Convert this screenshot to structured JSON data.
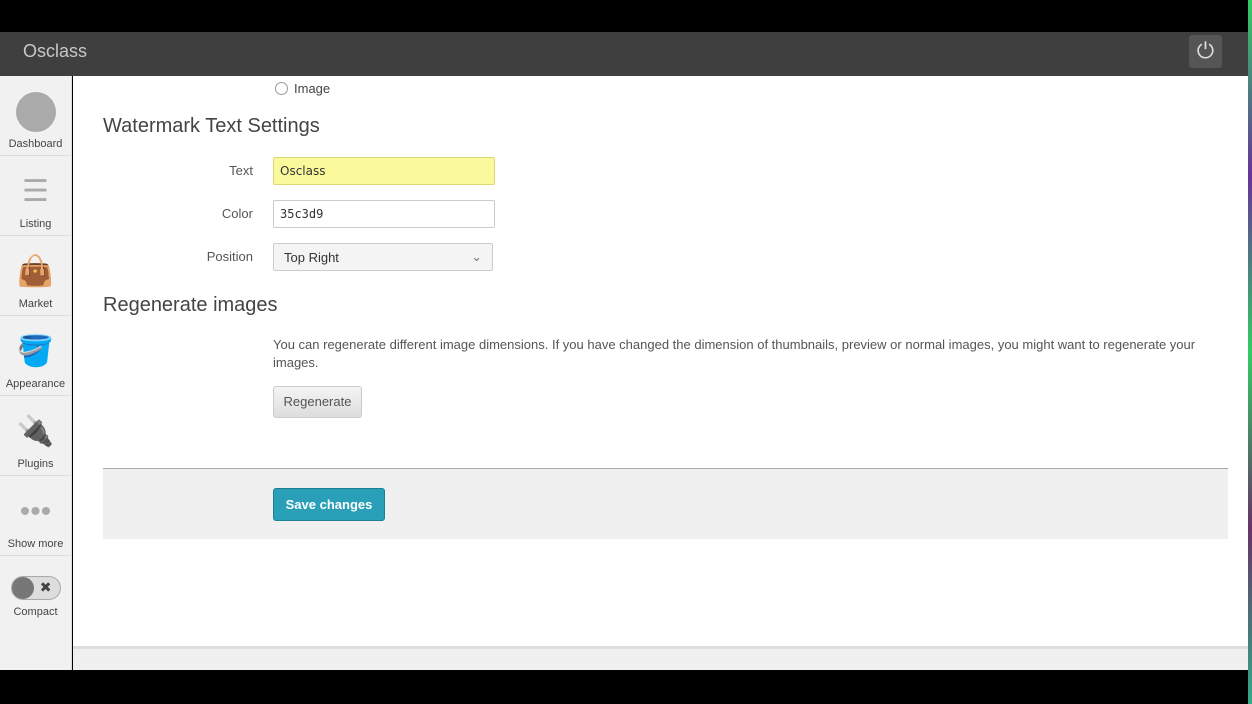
{
  "header": {
    "brand": "Osclass",
    "logout_icon": "power-icon"
  },
  "sidebar": {
    "items": [
      {
        "label": "Dashboard",
        "icon": "ninja-icon"
      },
      {
        "label": "Listing",
        "icon": "list-icon"
      },
      {
        "label": "Market",
        "icon": "bag-icon"
      },
      {
        "label": "Appearance",
        "icon": "paint-bucket-icon"
      },
      {
        "label": "Plugins",
        "icon": "plug-icon"
      },
      {
        "label": "Show more",
        "icon": "dots-icon"
      }
    ],
    "compact_label": "Compact"
  },
  "main": {
    "image_option": "Image",
    "watermark_title": "Watermark Text Settings",
    "text_label": "Text",
    "text_value": "Osclass",
    "color_label": "Color",
    "color_value": "35c3d9",
    "position_label": "Position",
    "position_value": "Top Right",
    "regen_title": "Regenerate images",
    "regen_desc": "You can regenerate different image dimensions. If you have changed the dimension of thumbnails, preview or normal images, you might want to regenerate your images.",
    "regen_button": "Regenerate",
    "save_button": "Save changes"
  },
  "colors": {
    "accent": "#2a9fb8",
    "topbar": "#3f3f3f",
    "text_highlight": "#fafa9c"
  }
}
